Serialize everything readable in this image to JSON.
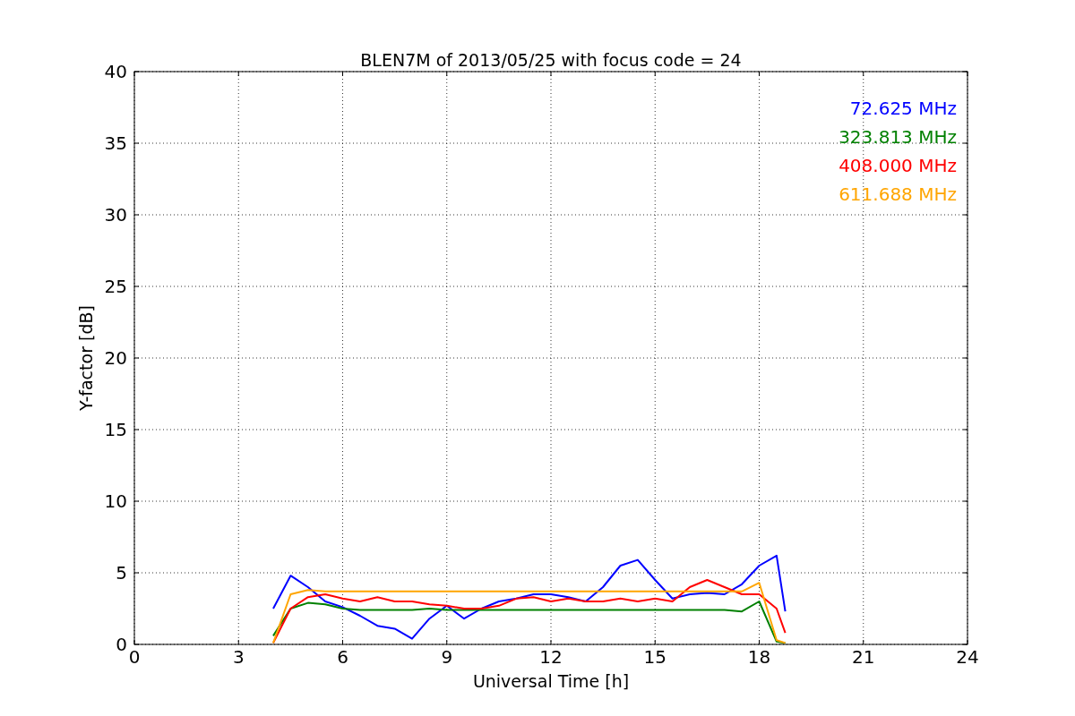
{
  "chart_data": {
    "type": "line",
    "title": "BLEN7M of 2013/05/25 with focus code = 24",
    "xlabel": "Universal Time [h]",
    "ylabel": "Y-factor [dB]",
    "x": [
      4,
      4.5,
      5,
      5.5,
      6,
      6.5,
      7,
      7.5,
      8,
      8.5,
      9,
      9.5,
      10,
      10.5,
      11,
      11.5,
      12,
      12.5,
      13,
      13.5,
      14,
      14.5,
      15,
      15.5,
      16,
      16.5,
      17,
      17.5,
      18,
      18.5,
      18.75
    ],
    "series": [
      {
        "name": "72.625 MHz",
        "color": "#0000ff",
        "values": [
          2.5,
          4.8,
          4,
          3,
          2.6,
          2,
          1.3,
          1.1,
          0.4,
          1.8,
          2.7,
          1.8,
          2.5,
          3,
          3.2,
          3.5,
          3.5,
          3.3,
          3,
          4,
          5.5,
          5.9,
          4.5,
          3.2,
          3.5,
          3.6,
          3.5,
          4.2,
          5.5,
          6.2,
          2.3
        ]
      },
      {
        "name": "323.813 MHz",
        "color": "#008000",
        "values": [
          0.6,
          2.5,
          2.9,
          2.8,
          2.5,
          2.4,
          2.4,
          2.4,
          2.4,
          2.5,
          2.4,
          2.4,
          2.4,
          2.4,
          2.4,
          2.4,
          2.4,
          2.4,
          2.4,
          2.4,
          2.4,
          2.4,
          2.4,
          2.4,
          2.4,
          2.4,
          2.4,
          2.3,
          3,
          0.2,
          0.1
        ]
      },
      {
        "name": "408.000 MHz",
        "color": "#ff0000",
        "values": [
          0.1,
          2.5,
          3.3,
          3.5,
          3.2,
          3,
          3.3,
          3,
          3,
          2.8,
          2.7,
          2.5,
          2.5,
          2.7,
          3.2,
          3.3,
          3,
          3.2,
          3,
          3,
          3.2,
          3,
          3.2,
          3,
          4,
          4.5,
          4,
          3.5,
          3.5,
          2.5,
          0.8
        ]
      },
      {
        "name": "611.688 MHz",
        "color": "#ffa500",
        "values": [
          0.1,
          3.5,
          3.8,
          3.7,
          3.7,
          3.7,
          3.7,
          3.7,
          3.7,
          3.7,
          3.7,
          3.7,
          3.7,
          3.7,
          3.7,
          3.7,
          3.7,
          3.7,
          3.7,
          3.7,
          3.7,
          3.7,
          3.7,
          3.7,
          3.7,
          3.7,
          3.7,
          3.7,
          4.3,
          0.3,
          0.1
        ]
      }
    ],
    "xlim": [
      0,
      24
    ],
    "ylim": [
      0,
      40
    ],
    "xticks": [
      0,
      3,
      6,
      9,
      12,
      15,
      18,
      21,
      24
    ],
    "yticks": [
      0,
      5,
      10,
      15,
      20,
      25,
      30,
      35,
      40
    ],
    "grid": true
  }
}
